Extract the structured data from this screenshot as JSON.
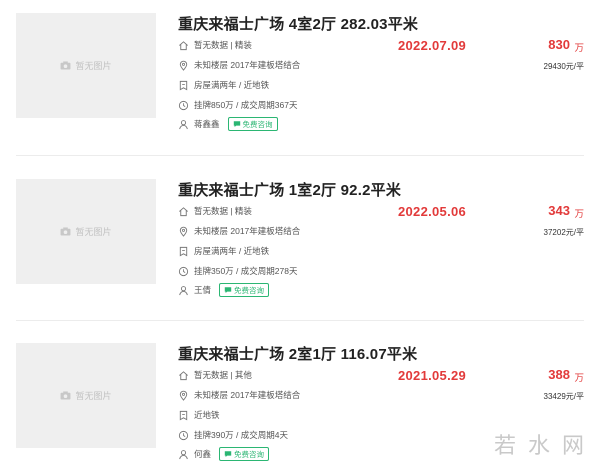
{
  "listings": [
    {
      "title": "重庆来福士广场 4室2厅 282.03平米",
      "image_placeholder": "暂无图片",
      "decoration_info": "暂无数据 | 精装",
      "floor_info": "未知楼层 2017年建板塔结合",
      "tag_info": "房屋满两年 / 近地铁",
      "listing_info": "挂牌850万 / 成交周期367天",
      "agent": "蒋鑫鑫",
      "consult_label": "免费咨询",
      "deal_date": "2022.07.09",
      "total_price": "830",
      "price_unit": "万",
      "unit_price": "29430元/平"
    },
    {
      "title": "重庆来福士广场 1室2厅 92.2平米",
      "image_placeholder": "暂无图片",
      "decoration_info": "暂无数据 | 精装",
      "floor_info": "未知楼层 2017年建板塔结合",
      "tag_info": "房屋满两年 / 近地铁",
      "listing_info": "挂牌350万 / 成交周期278天",
      "agent": "王倩",
      "consult_label": "免费咨询",
      "deal_date": "2022.05.06",
      "total_price": "343",
      "price_unit": "万",
      "unit_price": "37202元/平"
    },
    {
      "title": "重庆来福士广场 2室1厅 116.07平米",
      "image_placeholder": "暂无图片",
      "decoration_info": "暂无数据 | 其他",
      "floor_info": "未知楼层 2017年建板塔结合",
      "tag_info": "近地铁",
      "listing_info": "挂牌390万 / 成交周期4天",
      "agent": "何鑫",
      "consult_label": "免费咨询",
      "deal_date": "2021.05.29",
      "total_price": "388",
      "price_unit": "万",
      "unit_price": "33429元/平"
    }
  ],
  "watermark": [
    "若",
    "水",
    "网"
  ],
  "colors": {
    "price_red": "#e23a3a",
    "consult_green": "#2bb673",
    "placeholder_bg": "#efefef"
  },
  "icons": [
    "home-icon",
    "location-icon",
    "tag-icon",
    "clock-icon",
    "user-icon",
    "chat-icon",
    "camera-icon"
  ]
}
